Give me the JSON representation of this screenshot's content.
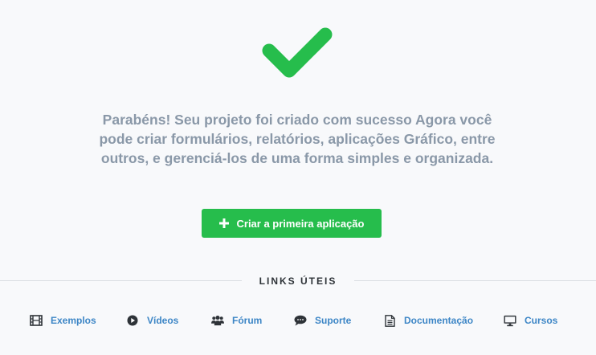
{
  "hero": {
    "message": "Parabéns! Seu projeto foi criado com sucesso Agora você pode criar formulários, relatórios, aplicações Gráfico, entre outros, e gerenciá-los de uma forma simples e organizada.",
    "check_icon": "check-icon",
    "check_color": "#26bd4c"
  },
  "primary_action": {
    "label": "Criar a primeira aplicação",
    "icon": "plus-icon",
    "color": "#26bd4c"
  },
  "useful_links": {
    "title": "LINKS ÚTEIS",
    "link_color": "#3d86c6",
    "items": [
      {
        "label": "Exemplos",
        "icon": "film-icon"
      },
      {
        "label": "Vídeos",
        "icon": "play-circle-icon"
      },
      {
        "label": "Fórum",
        "icon": "users-icon"
      },
      {
        "label": "Suporte",
        "icon": "chat-bubble-icon"
      },
      {
        "label": "Documentação",
        "icon": "document-icon"
      },
      {
        "label": "Cursos",
        "icon": "monitor-icon"
      }
    ]
  }
}
